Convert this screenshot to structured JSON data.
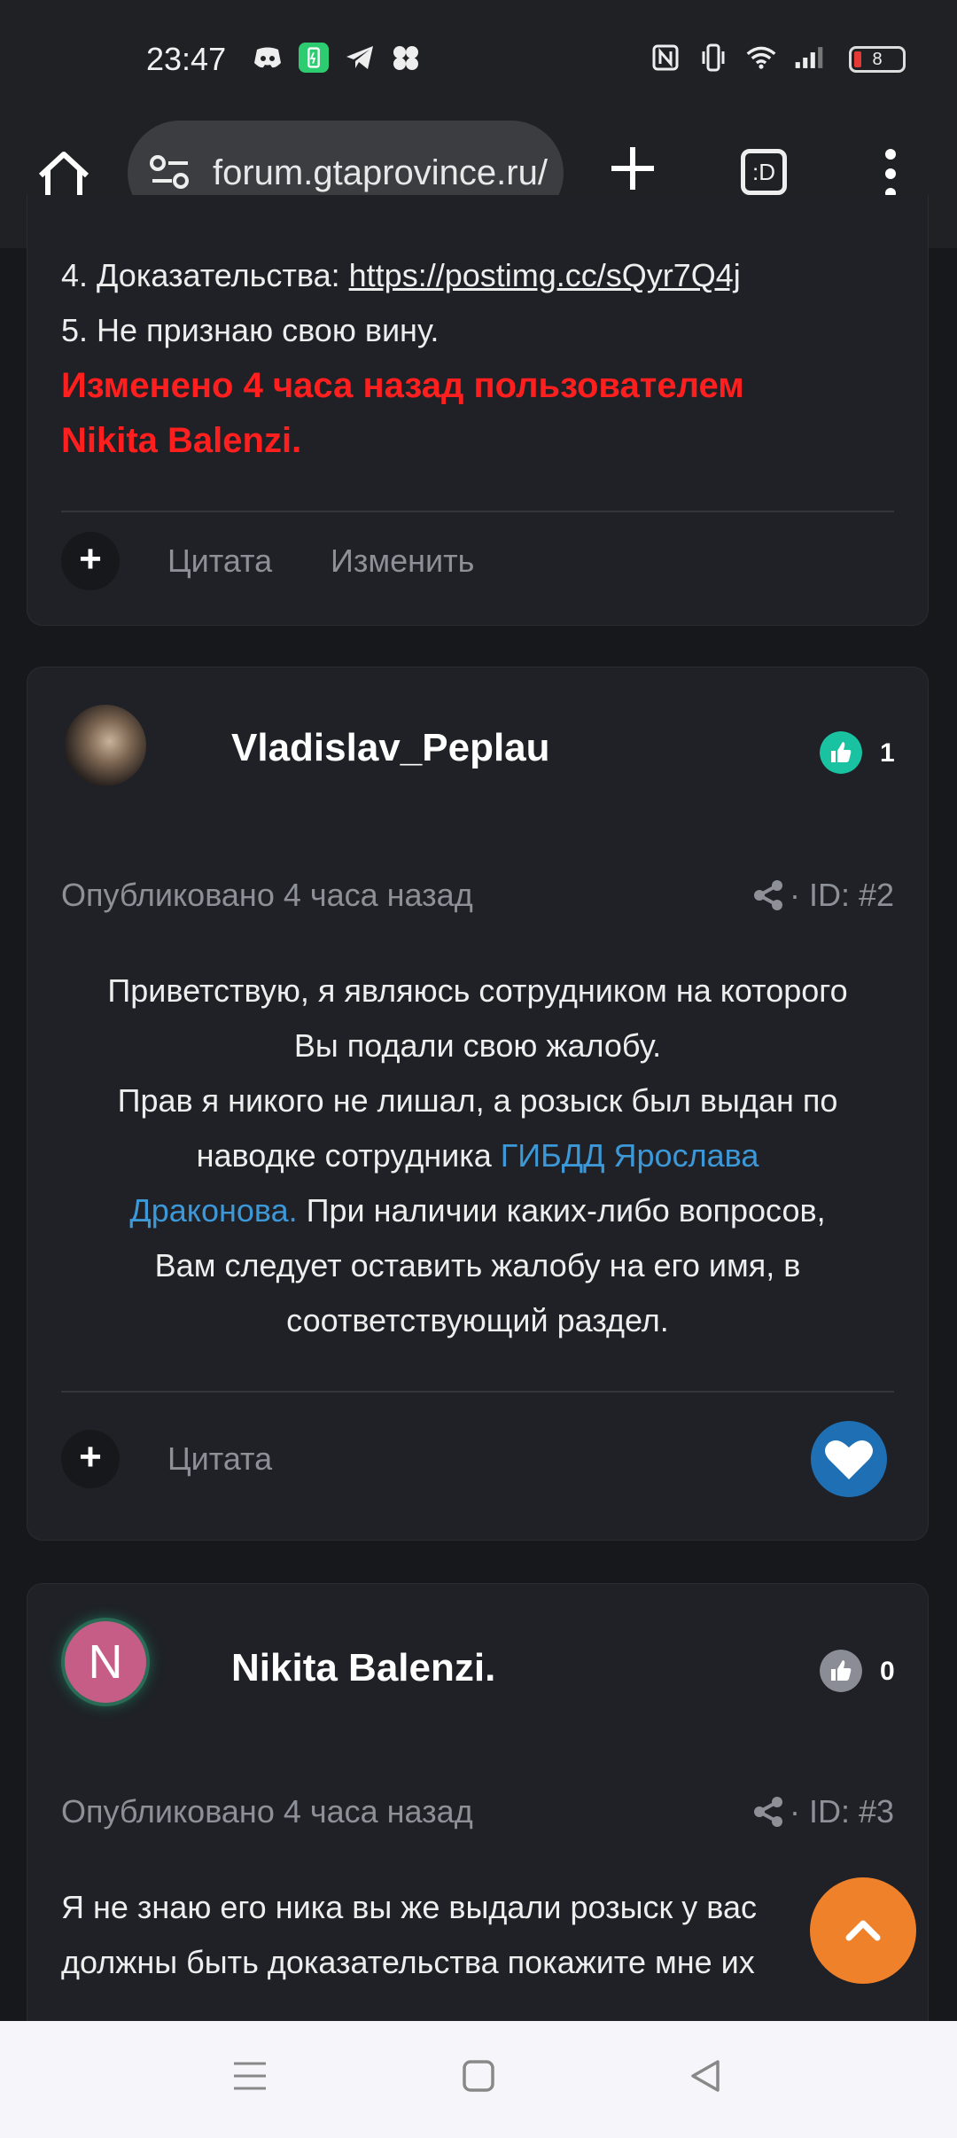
{
  "status_bar": {
    "time": "23:47",
    "battery": "8"
  },
  "browser": {
    "url": "forum.gtaprovince.ru/",
    "tabs_label": ":D"
  },
  "post1": {
    "line4_label": "4. Доказательства: ",
    "line4_link": "https://postimg.cc/sQyr7Q4j",
    "line5": "5. Не признаю свою вину.",
    "edit_note_line1": "Изменено 4 часа назад пользователем",
    "edit_note_line2": "Nikita Balenzi.",
    "quote_label": "Цитата",
    "edit_label": "Изменить"
  },
  "post2": {
    "username": "Vladislav_Peplau",
    "likes": "1",
    "published": "Опубликовано 4 часа назад",
    "post_id": "· ID: #2",
    "body_line1": "Приветствую, я являюсь сотрудником на которого",
    "body_line2": "Вы подали свою жалобу.",
    "body_line3": "Прав я никого не лишал, а розыск был выдан по",
    "body_line4_a": "наводке сотрудника ",
    "body_line4_link": "ГИБДД Ярослава",
    "body_line5_link": "Драконова.",
    "body_line5_b": " При наличии каких-либо вопросов,",
    "body_line6": "Вам следует оставить жалобу на его имя, в",
    "body_line7": "соответствующий раздел.",
    "quote_label": "Цитата"
  },
  "post3": {
    "avatar_letter": "N",
    "username": "Nikita Balenzi.",
    "likes": "0",
    "published": "Опубликовано 4 часа назад",
    "post_id": "· ID: #3",
    "body_line1": "Я не знаю его ника вы же выдали розыск у вас",
    "body_line2": "должны быть доказательства покажите мне их"
  },
  "colors": {
    "accent_teal": "#19c2a0",
    "link_blue": "#3d98d8",
    "edit_red": "#ff1f1f",
    "scroll_orange": "#f0812b"
  }
}
